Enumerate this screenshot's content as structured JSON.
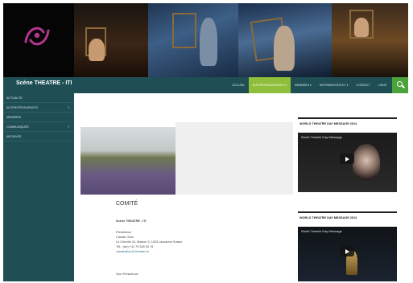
{
  "site": {
    "title": "Scène THEATRE - ITI"
  },
  "nav": {
    "items": [
      {
        "label": "ACCUEIL",
        "active": false
      },
      {
        "label": "AUTORITÉS/AGENCES ▾",
        "active": true
      },
      {
        "label": "MEMBRES ▾",
        "active": false
      },
      {
        "label": "INFORMATIONS ET ▾",
        "active": false
      },
      {
        "label": "CONTACT",
        "active": false
      },
      {
        "label": "LIENS",
        "active": false
      }
    ],
    "search_icon": "search-icon"
  },
  "sidebar": {
    "items": [
      {
        "label": "ACTUALITÉ",
        "has_submenu": false
      },
      {
        "label": "AUTORITÉS/AGENCES",
        "has_submenu": true
      },
      {
        "label": "MEMBRES",
        "has_submenu": false
      },
      {
        "label": "COMMUNIQUÉS",
        "has_submenu": true
      },
      {
        "label": "ARCHIVES",
        "has_submenu": false
      }
    ],
    "arrow": "›"
  },
  "main": {
    "title": "COMITÉ",
    "subtitle": "Scène THEATRE - ITI",
    "lines": [
      "Présidence",
      "Claude Ochs",
      "La Cheville 10, Maison 3, 1003 Lausanne Suisse",
      "Tél.: (sic) +41 79 345 00 78",
      "claude@ch-iti-theatre.ch",
      "Vice-Présidence"
    ]
  },
  "widgets": [
    {
      "title": "WORLD THEATRE DAY MESSAGE 2014",
      "video_caption": "World Theatre Day Message"
    },
    {
      "title": "WORLD THEATRE DAY MESSAGE 2013",
      "video_caption": "World Theatre Day Message"
    }
  ],
  "colors": {
    "teal": "#1f4f55",
    "green": "#8fbf3a",
    "search_green": "#4ba33b",
    "logo_magenta": "#b4368f"
  }
}
